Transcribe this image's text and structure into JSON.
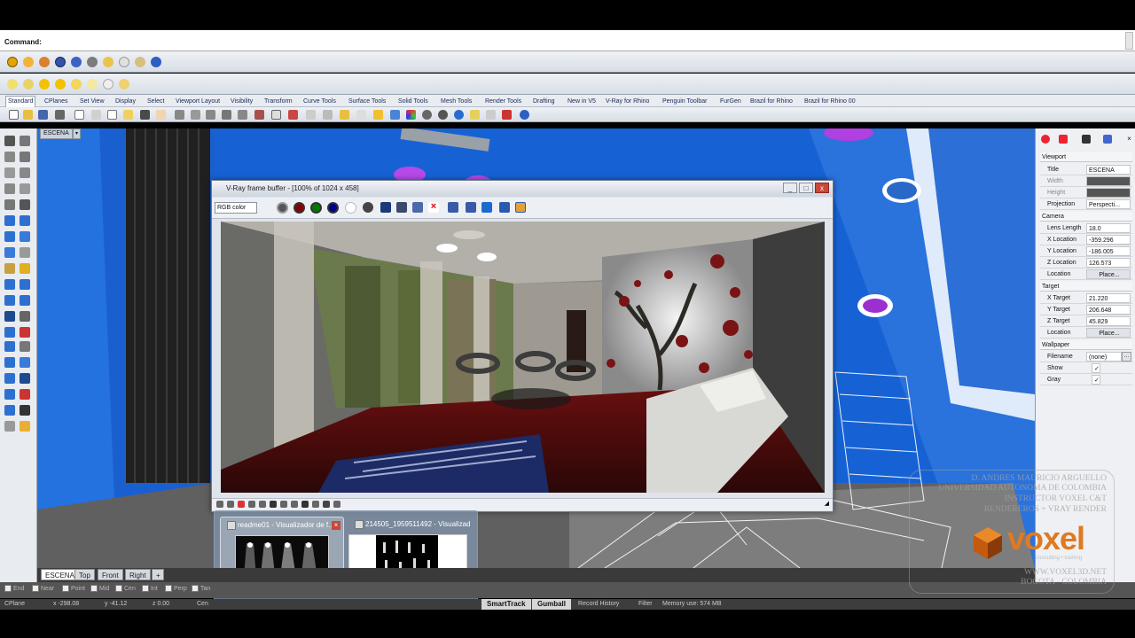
{
  "command": {
    "label": "Command:"
  },
  "tabs": [
    "Standard",
    "CPlanes",
    "Set View",
    "Display",
    "Select",
    "Viewport Layout",
    "Visibility",
    "Transform",
    "Curve Tools",
    "Surface Tools",
    "Solid Tools",
    "Mesh Tools",
    "Render Tools",
    "Drafting",
    "New in V5",
    "V-Ray for Rhino",
    "Penguin Toolbar",
    "FurGen",
    "Brazil for Rhino",
    "Brazil for Rhino 00"
  ],
  "viewport": {
    "title": "ESCENA",
    "dropdown": "▾"
  },
  "viewport_tabs": [
    "ESCENA",
    "Top",
    "Front",
    "Right"
  ],
  "osnap": [
    "End",
    "Near",
    "Point",
    "Mid",
    "Cen",
    "Int",
    "Perp",
    "Tan"
  ],
  "status": {
    "cplane": "CPlane",
    "x": "x -298.08",
    "y": "y -41.12",
    "z": "z 0.00",
    "layer": "Cen",
    "smarttrack": "SmartTrack",
    "gumball": "Gumball",
    "record": "Record History",
    "filter": "Filter",
    "memory": "Memory use: 574 MB"
  },
  "vfb": {
    "title": "V-Ray frame buffer - [100% of 1024 x 458]",
    "channel": "RGB color",
    "btn_min": "_",
    "btn_max": "□",
    "btn_close": "x"
  },
  "properties": {
    "viewport_head": "Viewport",
    "title_label": "Title",
    "title_value": "ESCENA",
    "width_label": "Width",
    "height_label": "Height",
    "projection_label": "Projection",
    "projection_value": "Perspecti...",
    "camera_head": "Camera",
    "lens_label": "Lens Length",
    "lens_value": "18.0",
    "xloc_label": "X Location",
    "xloc_value": "-359.296",
    "yloc_label": "Y Location",
    "yloc_value": "-186.005",
    "zloc_label": "Z Location",
    "zloc_value": "126.573",
    "loc_label": "Location",
    "loc_btn": "Place...",
    "target_head": "Target",
    "xt_label": "X Target",
    "xt_value": "21.220",
    "yt_label": "Y Target",
    "yt_value": "206.648",
    "zt_label": "Z Target",
    "zt_value": "45.829",
    "tloc_label": "Location",
    "tloc_btn": "Place...",
    "wall_head": "Wallpaper",
    "file_label": "Filename",
    "file_value": "(none)",
    "show_label": "Show",
    "show_check": "✓",
    "gray_label": "Gray",
    "gray_check": "✓"
  },
  "previews": [
    {
      "title": "readme01 - Visualizador de f..."
    },
    {
      "title": "214505_1959511492 - Visualizad..."
    }
  ],
  "watermark": {
    "line1": "D. ANDRES MAURICIO ARGUELLO",
    "line2": "UNIVERSIDAD AUTONOMA DE COLOMBIA",
    "line3": "INSTRUCTOR VOXEL C&T",
    "line4": "RENDEREROS + VRAY RENDER",
    "brand": "voxel",
    "tagline": "consulting • training",
    "url": "WWW.VOXEL3D.NET",
    "city": "BOGOTA - COLOMBIA"
  }
}
